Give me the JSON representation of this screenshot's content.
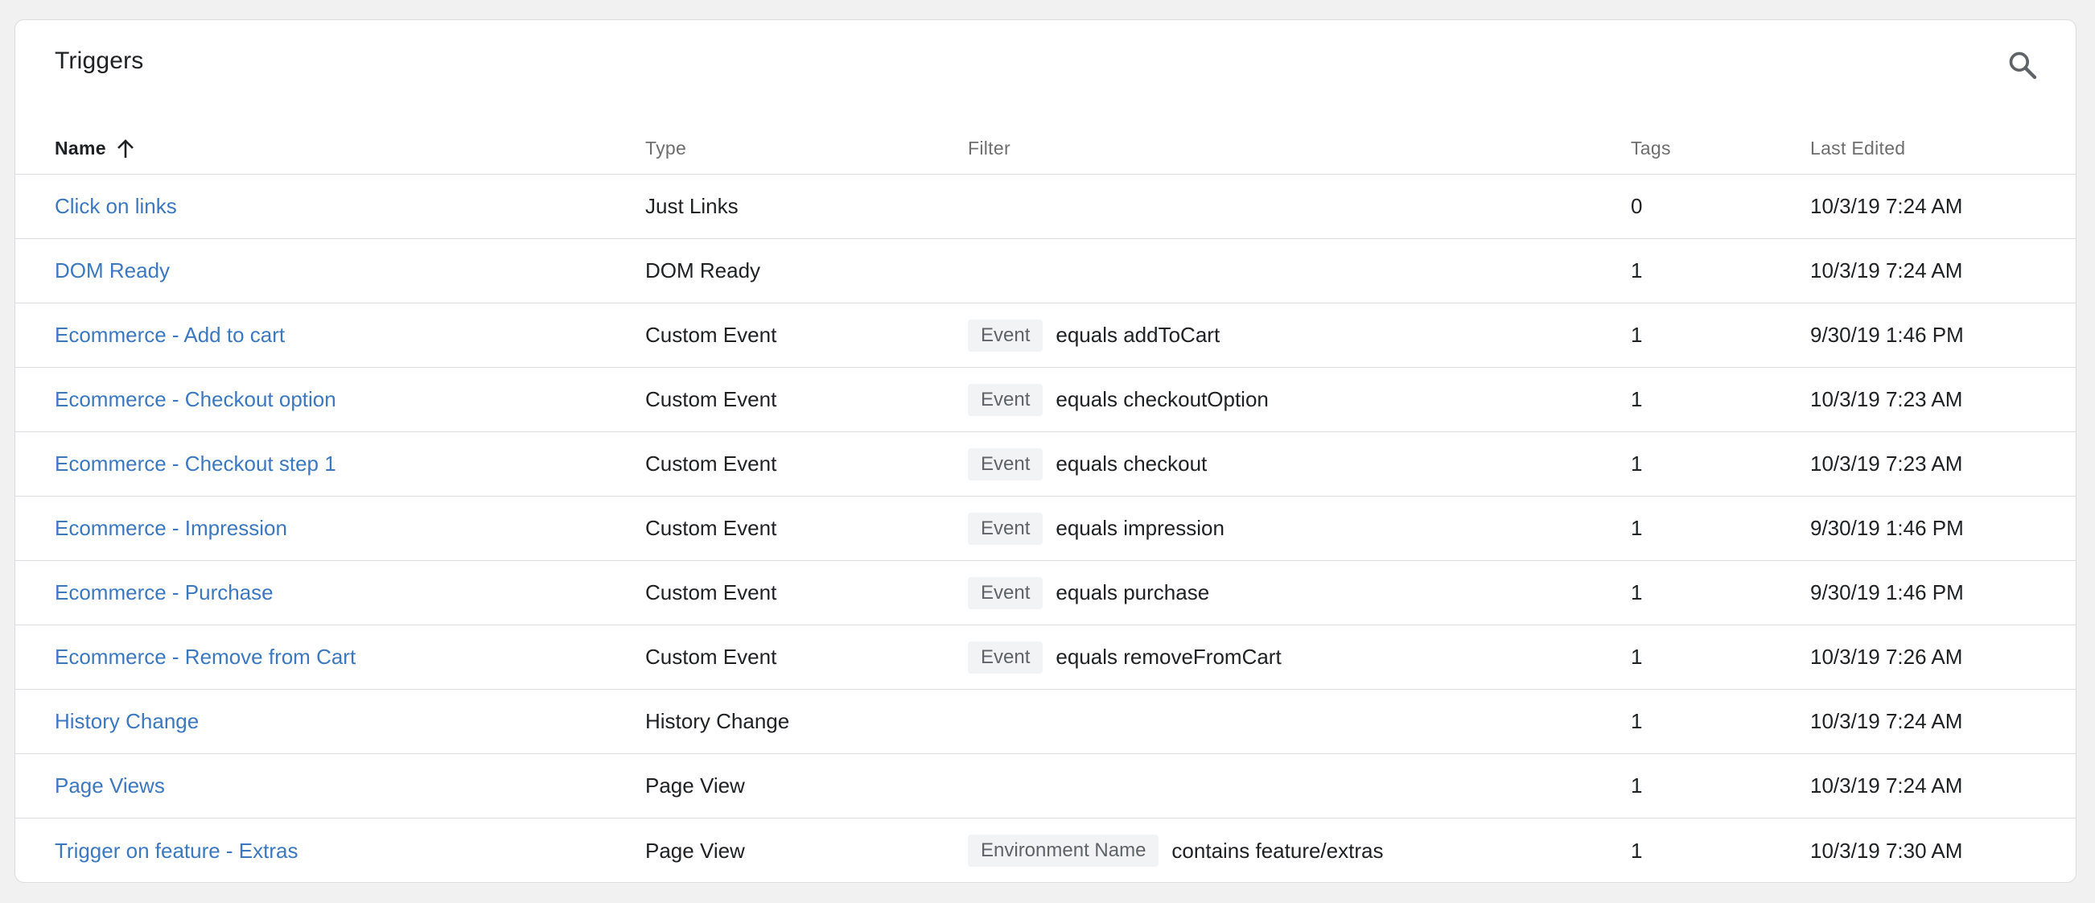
{
  "header": {
    "title": "Triggers",
    "search_icon": "search-icon"
  },
  "columns": {
    "name": "Name",
    "type": "Type",
    "filter": "Filter",
    "tags": "Tags",
    "last_edited": "Last Edited",
    "sort_icon": "arrow-up-icon"
  },
  "rows": [
    {
      "name": "Click on links",
      "type": "Just Links",
      "filter_chip": "",
      "filter_text": "",
      "tags": "0",
      "last_edited": "10/3/19 7:24 AM"
    },
    {
      "name": "DOM Ready",
      "type": "DOM Ready",
      "filter_chip": "",
      "filter_text": "",
      "tags": "1",
      "last_edited": "10/3/19 7:24 AM"
    },
    {
      "name": "Ecommerce - Add to cart",
      "type": "Custom Event",
      "filter_chip": "Event",
      "filter_text": "equals addToCart",
      "tags": "1",
      "last_edited": "9/30/19 1:46 PM"
    },
    {
      "name": "Ecommerce - Checkout option",
      "type": "Custom Event",
      "filter_chip": "Event",
      "filter_text": "equals checkoutOption",
      "tags": "1",
      "last_edited": "10/3/19 7:23 AM"
    },
    {
      "name": "Ecommerce - Checkout step 1",
      "type": "Custom Event",
      "filter_chip": "Event",
      "filter_text": "equals checkout",
      "tags": "1",
      "last_edited": "10/3/19 7:23 AM"
    },
    {
      "name": "Ecommerce - Impression",
      "type": "Custom Event",
      "filter_chip": "Event",
      "filter_text": "equals impression",
      "tags": "1",
      "last_edited": "9/30/19 1:46 PM"
    },
    {
      "name": "Ecommerce - Purchase",
      "type": "Custom Event",
      "filter_chip": "Event",
      "filter_text": "equals purchase",
      "tags": "1",
      "last_edited": "9/30/19 1:46 PM"
    },
    {
      "name": "Ecommerce - Remove from Cart",
      "type": "Custom Event",
      "filter_chip": "Event",
      "filter_text": "equals removeFromCart",
      "tags": "1",
      "last_edited": "10/3/19 7:26 AM"
    },
    {
      "name": "History Change",
      "type": "History Change",
      "filter_chip": "",
      "filter_text": "",
      "tags": "1",
      "last_edited": "10/3/19 7:24 AM"
    },
    {
      "name": "Page Views",
      "type": "Page View",
      "filter_chip": "",
      "filter_text": "",
      "tags": "1",
      "last_edited": "10/3/19 7:24 AM"
    },
    {
      "name": "Trigger on feature - Extras",
      "type": "Page View",
      "filter_chip": "Environment Name",
      "filter_text": "contains feature/extras",
      "tags": "1",
      "last_edited": "10/3/19 7:30 AM"
    }
  ],
  "colors": {
    "link": "#3c78c0",
    "chip_bg": "#f1f3f4",
    "divider": "#dadce0"
  }
}
